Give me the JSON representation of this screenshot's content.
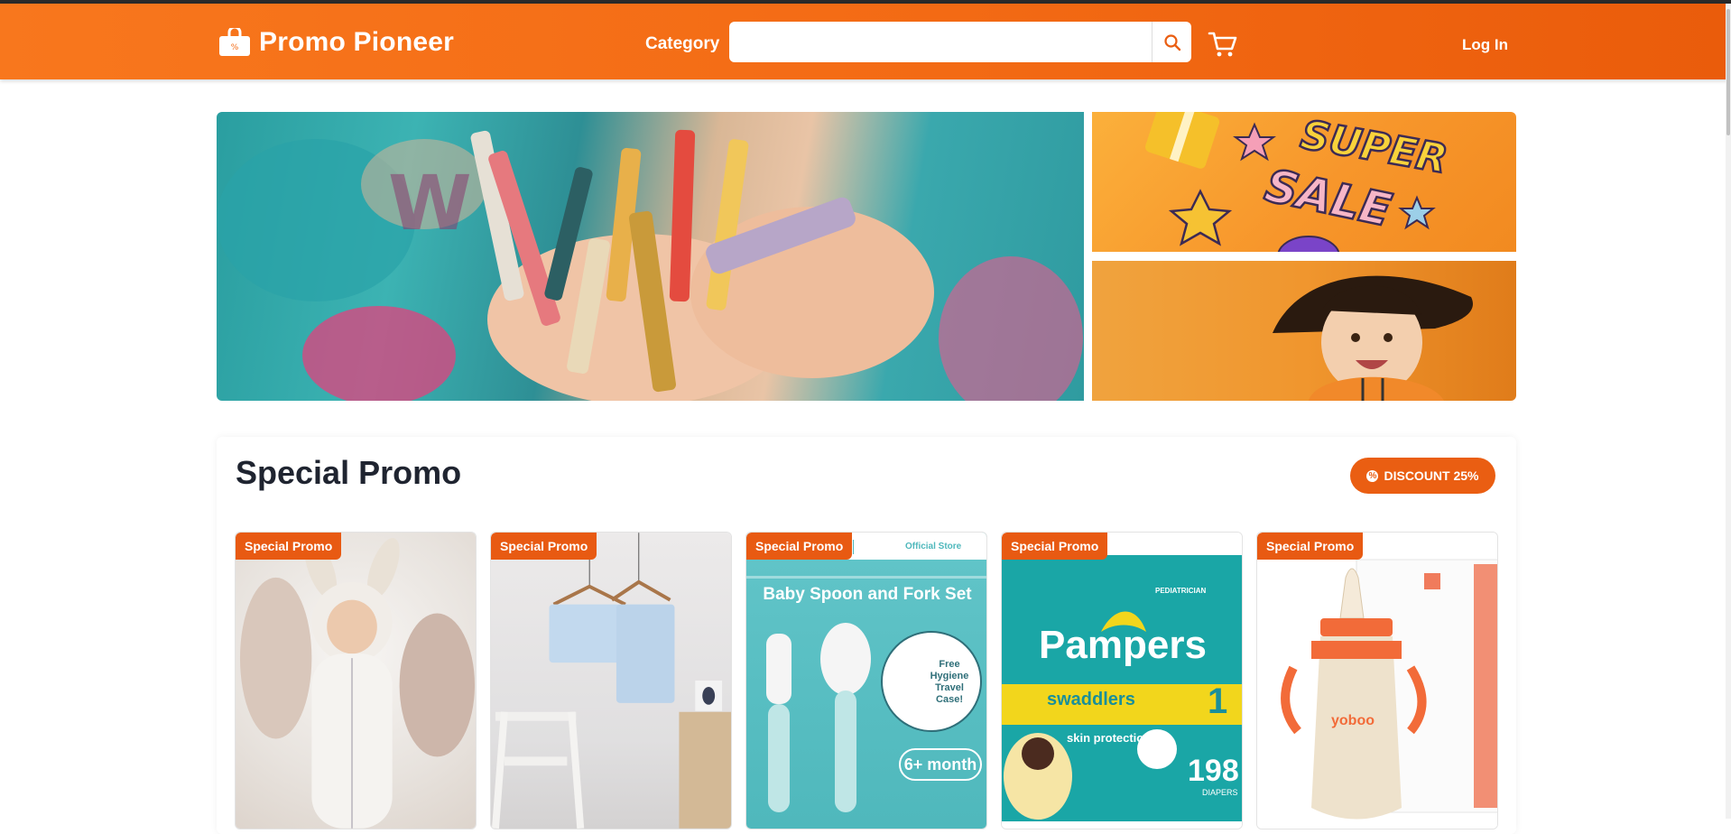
{
  "header": {
    "brand": "Promo Pioneer",
    "category_label": "Category",
    "search_placeholder": "",
    "login_label": "Log In"
  },
  "banner": {
    "main_alt": "Child hands holding crayons",
    "side_top_text": "SUPER SALE",
    "slide_count": 3,
    "active_slide": 1
  },
  "promo": {
    "title": "Special Promo",
    "discount_label": "DISCOUNT 25%",
    "products": [
      {
        "tag": "Special Promo"
      },
      {
        "tag": "Special Promo"
      },
      {
        "tag": "Special Promo",
        "image_text": "Baby Spoon and Fork Set",
        "image_sub": "6+ month",
        "image_note": "Free Hygiene Travel Case!",
        "image_store": "Official Store"
      },
      {
        "tag": "Special Promo",
        "image_text": "Pampers",
        "image_sub": "swaddlers",
        "image_count": "198",
        "image_unit": "DIAPERS",
        "image_size": "1",
        "image_note": "skin protection",
        "image_badge": "PEDIATRICIAN"
      },
      {
        "tag": "Special Promo",
        "image_text": "yoboo"
      }
    ]
  },
  "colors": {
    "brand_orange": "#f36a14",
    "badge_orange": "#ea5e12",
    "active_dot": "#1e6df2"
  }
}
